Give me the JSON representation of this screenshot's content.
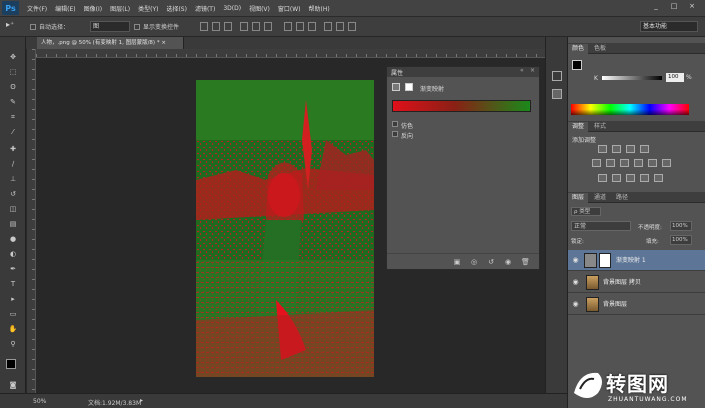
{
  "app": {
    "logo": "Ps"
  },
  "menu": [
    "文件(F)",
    "编辑(E)",
    "图像(I)",
    "图层(L)",
    "类型(Y)",
    "选择(S)",
    "滤镜(T)",
    "3D(D)",
    "视图(V)",
    "窗口(W)",
    "帮助(H)"
  ],
  "window_controls": [
    "_",
    "□",
    "×"
  ],
  "options": {
    "auto_select_label": "自动选择：",
    "auto_select_value": "图",
    "show_transform": "显示变换控件",
    "workspace": "基本功能"
  },
  "document_tab": {
    "title": "人物，.png @ 50% (有变映射 1, 图层蒙版/8) * ×"
  },
  "status": {
    "zoom": "50%",
    "doc_info": "文档:1.92M/3.83M"
  },
  "properties_panel": {
    "title": "属性",
    "type": "渐变映射",
    "dither_label": "仿色",
    "reverse_label": "反向"
  },
  "color_panel": {
    "tabs": [
      "颜色",
      "色板"
    ],
    "channel_label": "K",
    "value": "100",
    "unit": "%"
  },
  "adjustments_panel": {
    "tabs": [
      "调整",
      "样式"
    ],
    "add_label": "添加调整"
  },
  "layers_panel": {
    "tabs": [
      "图层",
      "通道",
      "路径"
    ],
    "filter_label": "ρ 类型",
    "blend_mode": "正常",
    "opacity_label": "不透明度:",
    "opacity_value": "100%",
    "lock_label": "锁定:",
    "fill_label": "填充:",
    "fill_value": "100%",
    "layers": [
      {
        "name": "渐变映射 1",
        "selected": true
      },
      {
        "name": "背景图层 拷贝",
        "selected": false
      },
      {
        "name": "背景图层",
        "selected": false
      }
    ]
  },
  "watermark": {
    "brand": "转图网",
    "domain": "ZHUANTUWANG.COM"
  }
}
